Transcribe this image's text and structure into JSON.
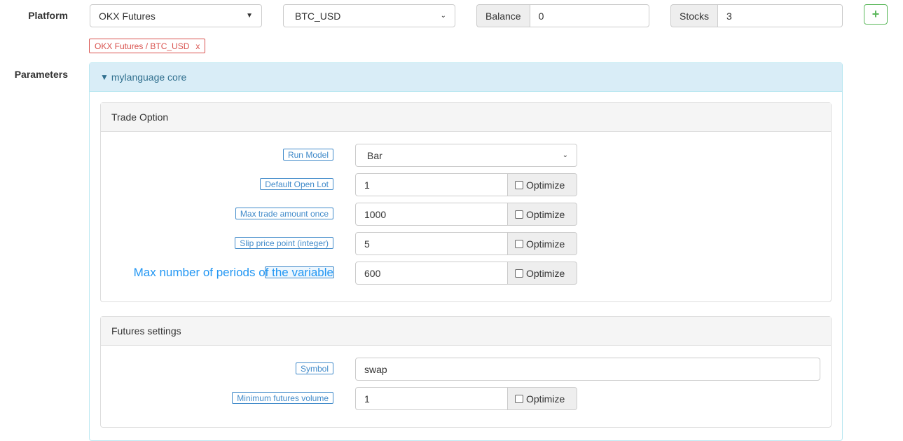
{
  "platform": {
    "label": "Platform",
    "exchange": "OKX Futures",
    "pair": "BTC_USD",
    "balance_label": "Balance",
    "balance": "0",
    "stocks_label": "Stocks",
    "stocks": "3",
    "add": "+",
    "tag": "OKX Futures / BTC_USD",
    "tag_close": "x"
  },
  "parameters": {
    "label": "Parameters",
    "group": "mylanguage core",
    "trade_option": {
      "title": "Trade Option",
      "run_model_label": "Run Model",
      "run_model": "Bar",
      "rows": [
        {
          "label": "Default Open Lot",
          "value": "1"
        },
        {
          "label": "Max trade amount once",
          "value": "1000"
        },
        {
          "label": "Slip price point (integer)",
          "value": "5"
        },
        {
          "label": "Max number of periods of the variable",
          "value": "600"
        }
      ]
    },
    "futures": {
      "title": "Futures settings",
      "symbol_label": "Symbol",
      "symbol": "swap",
      "min_label": "Minimum futures volume",
      "min_value": "1"
    },
    "optimize": "Optimize"
  }
}
